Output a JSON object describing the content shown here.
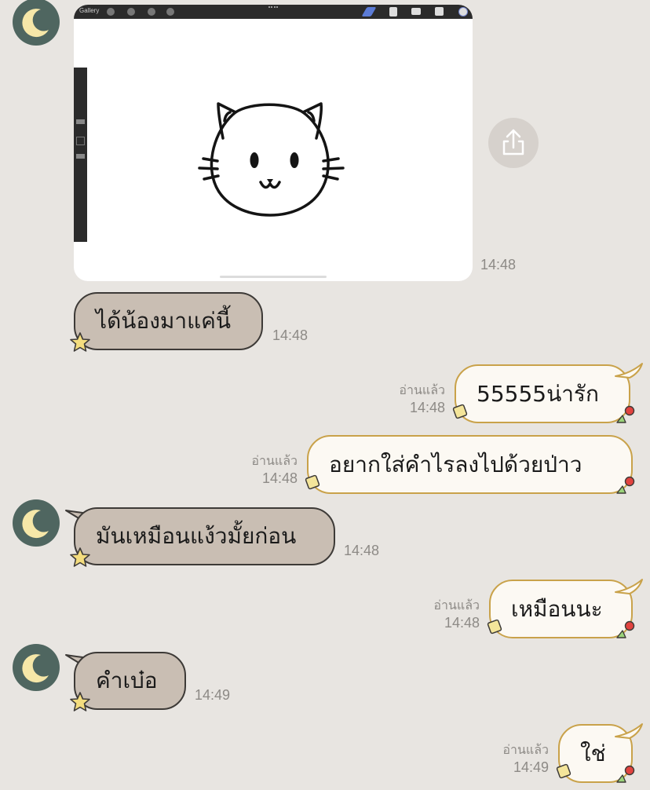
{
  "drawing_toolbar": {
    "gallery_label": "Gallery"
  },
  "messages": [
    {
      "side": "in",
      "type": "image",
      "time": "14:48"
    },
    {
      "side": "in",
      "type": "text",
      "text": "ได้น้องมาแค่นี้",
      "time": "14:48"
    },
    {
      "side": "out",
      "type": "text",
      "text": "55555น่ารัก",
      "read": "อ่านแล้ว",
      "time": "14:48"
    },
    {
      "side": "out",
      "type": "text",
      "text": "อยากใส่คำไรลงไปด้วยป่าว",
      "read": "อ่านแล้ว",
      "time": "14:48"
    },
    {
      "side": "in",
      "type": "text",
      "text": "มันเหมือนแง้วมั้ยก่อน",
      "time": "14:48"
    },
    {
      "side": "out",
      "type": "text",
      "text": "เหมือนนะ",
      "read": "อ่านแล้ว",
      "time": "14:48"
    },
    {
      "side": "in",
      "type": "text",
      "text": "คำเบ๋อ",
      "time": "14:49"
    },
    {
      "side": "out",
      "type": "text",
      "text": "ใช่",
      "read": "อ่านแล้ว",
      "time": "14:49"
    }
  ],
  "icons": {
    "avatar": "crescent-moon-icon",
    "share": "share-icon",
    "incoming_bubble_decoration": "star-icon",
    "outgoing_bubble_decoration": "leaf-berry-icon"
  },
  "colors": {
    "background": "#e8e5e1",
    "avatar_bg": "#4f6660",
    "moon": "#f6e7a8",
    "incoming_bubble": "#c9beb3",
    "outgoing_bubble": "#fcf9f3",
    "outgoing_border": "#c9a24a"
  }
}
